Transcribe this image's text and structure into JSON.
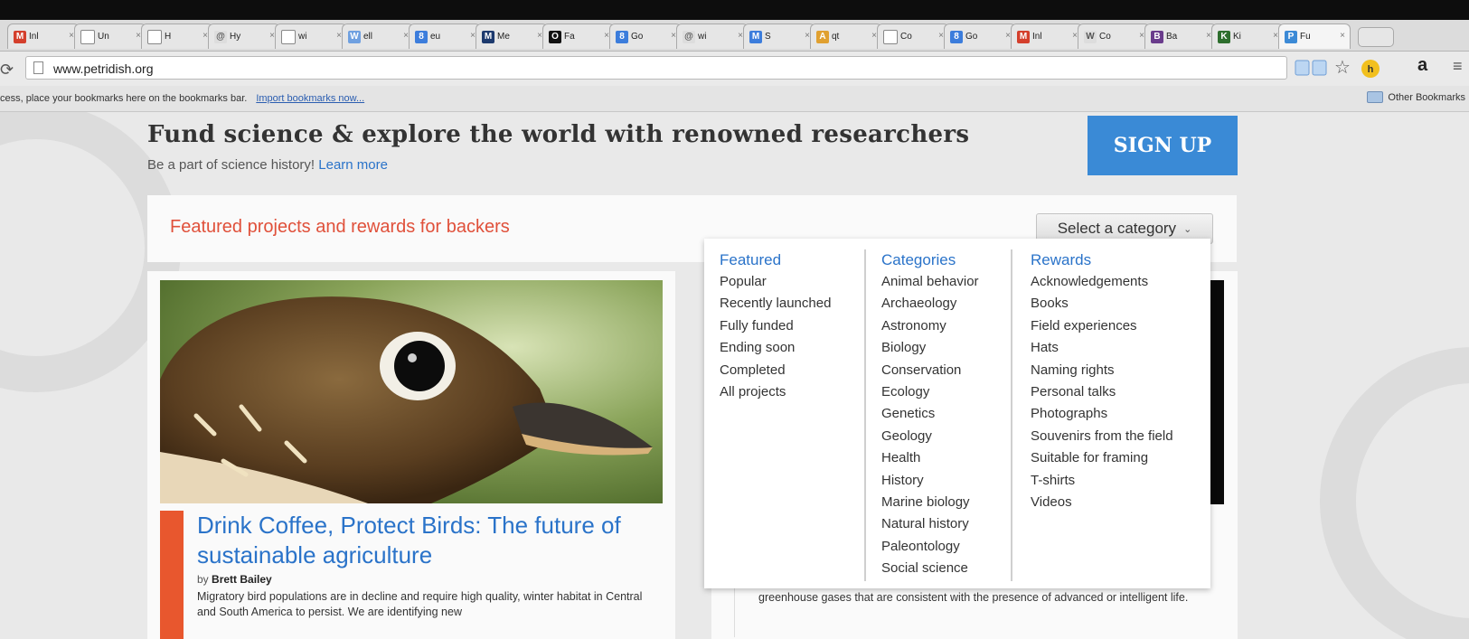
{
  "browser": {
    "tabs": [
      {
        "label": "Inl",
        "fav": "M",
        "fav_color": "#d43f2c"
      },
      {
        "label": "Un",
        "fav": "",
        "fav_color": "#ffffff"
      },
      {
        "label": "H",
        "fav": "",
        "fav_color": "#ffffff"
      },
      {
        "label": "Hy",
        "fav": "@",
        "fav_color": "#dddddd"
      },
      {
        "label": "wi",
        "fav": "",
        "fav_color": "#ffffff"
      },
      {
        "label": "ell",
        "fav": "W",
        "fav_color": "#6fa0e0"
      },
      {
        "label": "eu",
        "fav": "8",
        "fav_color": "#3c7ddc"
      },
      {
        "label": "Me",
        "fav": "M",
        "fav_color": "#1d3a6e"
      },
      {
        "label": "Fa",
        "fav": "O",
        "fav_color": "#111111"
      },
      {
        "label": "Go",
        "fav": "8",
        "fav_color": "#3c7ddc"
      },
      {
        "label": "wi",
        "fav": "@",
        "fav_color": "#dddddd"
      },
      {
        "label": "S",
        "fav": "M",
        "fav_color": "#3c7ddc"
      },
      {
        "label": "qt",
        "fav": "A",
        "fav_color": "#e0a030"
      },
      {
        "label": "Co",
        "fav": "",
        "fav_color": "#ffffff"
      },
      {
        "label": "Go",
        "fav": "8",
        "fav_color": "#3c7ddc"
      },
      {
        "label": "Inl",
        "fav": "M",
        "fav_color": "#d43f2c"
      },
      {
        "label": "Co",
        "fav": "W",
        "fav_color": "#dddddd"
      },
      {
        "label": "Ba",
        "fav": "B",
        "fav_color": "#6a3c8c"
      },
      {
        "label": "Ki",
        "fav": "K",
        "fav_color": "#2d6e2d"
      },
      {
        "label": "Fu",
        "fav": "P",
        "fav_color": "#3c8ad6"
      }
    ],
    "url": "www.petridish.org",
    "bookmarks_hint": "cess, place your bookmarks here on the bookmarks bar.",
    "import_link": "Import bookmarks now...",
    "other_bookmarks": "Other Bookmarks"
  },
  "page": {
    "headline": "Fund science & explore the world with renowned researchers",
    "subline": "Be a part of science history!",
    "learn_more": "Learn more",
    "signup": "SIGN UP",
    "featured_title": "Featured projects and rewards for backers",
    "category_select": "Select a category",
    "project1": {
      "title": "Drink Coffee, Protect Birds: The future of sustainable agriculture",
      "by": "by",
      "author": "Brett Bailey",
      "desc": "Migratory bird populations are in decline and require high quality, winter habitat in Central and South America to persist. We are identifying new"
    },
    "project2": {
      "desc": "greenhouse gases that are consistent with the presence of advanced or intelligent life."
    }
  },
  "dropdown": {
    "featured": {
      "heading": "Featured",
      "items": [
        "Popular",
        "Recently launched",
        "Fully funded",
        "Ending soon",
        "Completed",
        "All projects"
      ]
    },
    "categories": {
      "heading": "Categories",
      "items": [
        "Animal behavior",
        "Archaeology",
        "Astronomy",
        "Biology",
        "Conservation",
        "Ecology",
        "Genetics",
        "Geology",
        "Health",
        "History",
        "Marine biology",
        "Natural history",
        "Paleontology",
        "Social science"
      ]
    },
    "rewards": {
      "heading": "Rewards",
      "items": [
        "Acknowledgements",
        "Books",
        "Field experiences",
        "Hats",
        "Naming rights",
        "Personal talks",
        "Photographs",
        "Souvenirs from the field",
        "Suitable for framing",
        "T-shirts",
        "Videos"
      ]
    }
  }
}
